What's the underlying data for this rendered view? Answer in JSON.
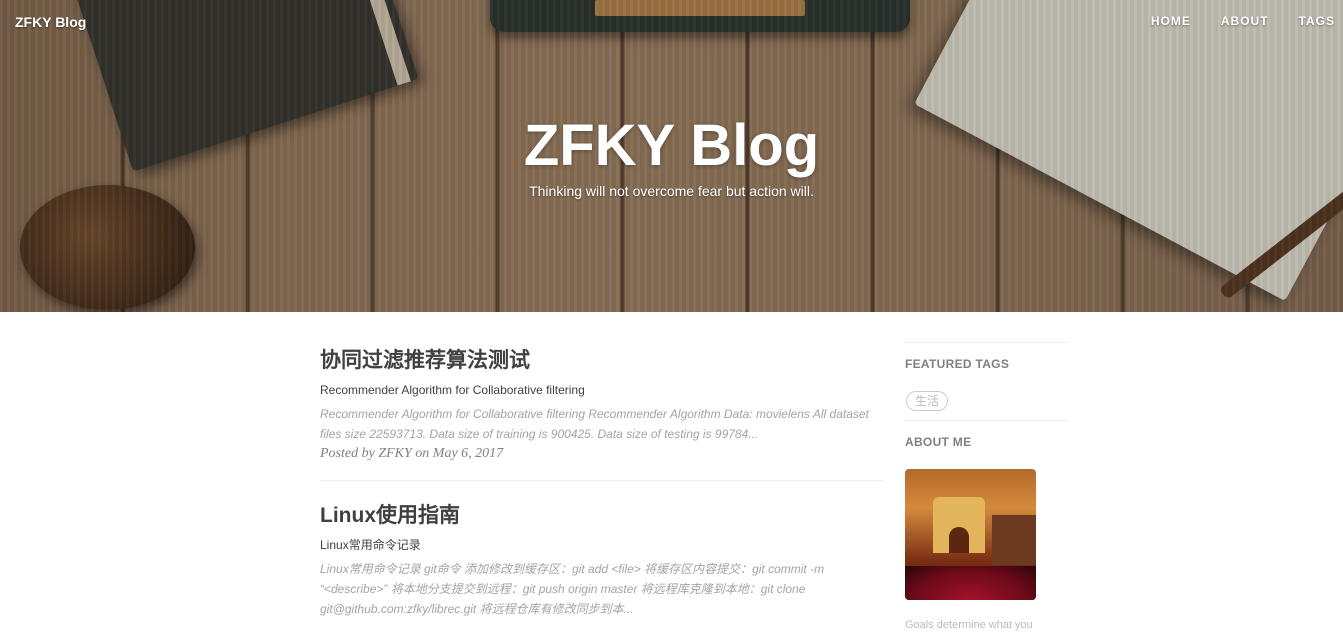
{
  "nav": {
    "brand": "ZFKY Blog",
    "links": [
      "HOME",
      "ABOUT",
      "TAGS"
    ]
  },
  "hero": {
    "title": "ZFKY Blog",
    "subtitle": "Thinking will not overcome fear but action will."
  },
  "posts": [
    {
      "title": "协同过滤推荐算法测试",
      "subtitle": "Recommender Algorithm for Collaborative filtering",
      "excerpt": "Recommender Algorithm for Collaborative filtering Recommender Algorithm Data: movielens All dataset files size 22593713. Data size of training is 900425. Data size of testing is 99784...",
      "meta": "Posted by ZFKY on May 6, 2017"
    },
    {
      "title": "Linux使用指南",
      "subtitle": "Linux常用命令记录",
      "excerpt": "Linux常用命令记录 git命令 添加修改到缓存区：git add <file> 将缓存区内容提交：git commit -m “<describe>” 将本地分支提交到远程：git push origin master 将远程库克隆到本地：git clone git@github.com:zfky/librec.git 将远程仓库有修改同步到本..."
    }
  ],
  "sidebar": {
    "featured_heading": "FEATURED TAGS",
    "tags": [
      "生活"
    ],
    "about_heading": "ABOUT ME",
    "about_text": "Goals determine what you"
  }
}
